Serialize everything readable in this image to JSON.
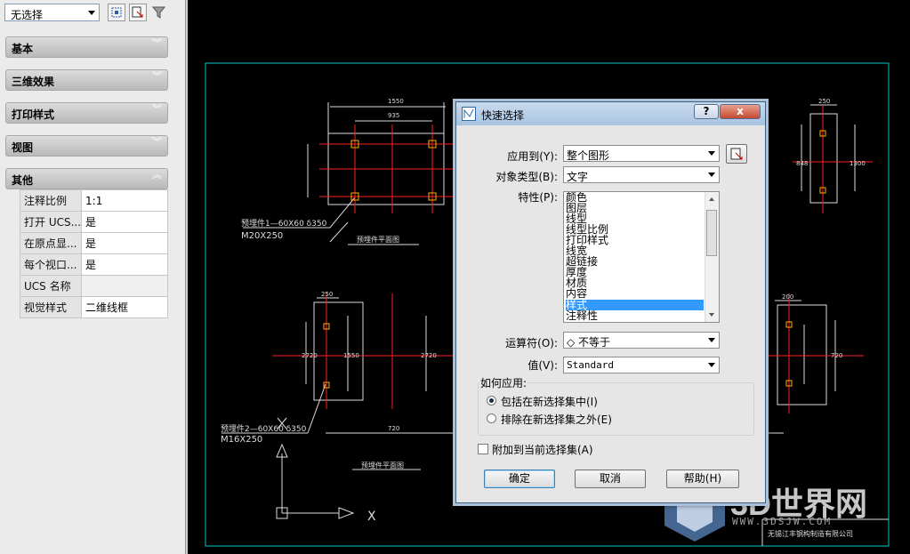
{
  "palette": {
    "select_value": "无选择",
    "sections": [
      {
        "label": "基本",
        "state": "collapsed"
      },
      {
        "label": "三维效果",
        "state": "collapsed"
      },
      {
        "label": "打印样式",
        "state": "collapsed"
      },
      {
        "label": "视图",
        "state": "collapsed"
      },
      {
        "label": "其他",
        "state": "expanded"
      }
    ],
    "properties": [
      {
        "key": "注释比例",
        "value": "1:1"
      },
      {
        "key": "打开 UCS...",
        "value": "是"
      },
      {
        "key": "在原点显...",
        "value": "是"
      },
      {
        "key": "每个视口...",
        "value": "是"
      },
      {
        "key": "UCS 名称",
        "value": ""
      },
      {
        "key": "视觉样式",
        "value": "二维线框"
      }
    ],
    "icons": [
      "quick-select-icon",
      "toggle-pickadd-icon",
      "select-objects-icon"
    ]
  },
  "dialog": {
    "title": "快速选择",
    "help_q": "?",
    "close": "x",
    "apply_to_label": "应用到(Y):",
    "apply_to_value": "整个图形",
    "object_type_label": "对象类型(B):",
    "object_type_value": "文字",
    "properties_label": "特性(P):",
    "properties_list": [
      "颜色",
      "图层",
      "线型",
      "线型比例",
      "打印样式",
      "线宽",
      "超链接",
      "厚度",
      "材质",
      "内容",
      "样式",
      "注释性"
    ],
    "selected_property": "样式",
    "operator_label": "运算符(O):",
    "operator_value": "◇ 不等于",
    "value_label": "值(V):",
    "value_value": "Standard",
    "how_to_apply": "如何应用:",
    "radio_include": "包括在新选择集中(I)",
    "radio_exclude": "排除在新选择集之外(E)",
    "append_label": "附加到当前选择集(A)",
    "ok": "确定",
    "cancel": "取消",
    "help": "帮助(H)"
  },
  "drawing": {
    "dims": [
      "1550",
      "935",
      "250",
      "848",
      "1300",
      "250",
      "1550",
      "2720",
      "200",
      "2720",
      "720",
      "720"
    ],
    "notes": [
      "预埋件1—60X60 δ350",
      "M20X250",
      "预埋件2—60X60 δ350",
      "M16X250"
    ],
    "titles": [
      "预埋件平面图",
      "预埋件平面图"
    ],
    "company": "无锡江丰钢构制造有限公司",
    "axis_x": "X"
  },
  "watermark": {
    "brand": "3D世界网",
    "url": "WWW.3DSJW.COM"
  },
  "colors": {
    "accent": "#3399ff",
    "drawing_bg": "#000000",
    "cad_red": "#ff2020",
    "cad_white": "#ffffff",
    "frame_cyan": "#00c8c8"
  }
}
